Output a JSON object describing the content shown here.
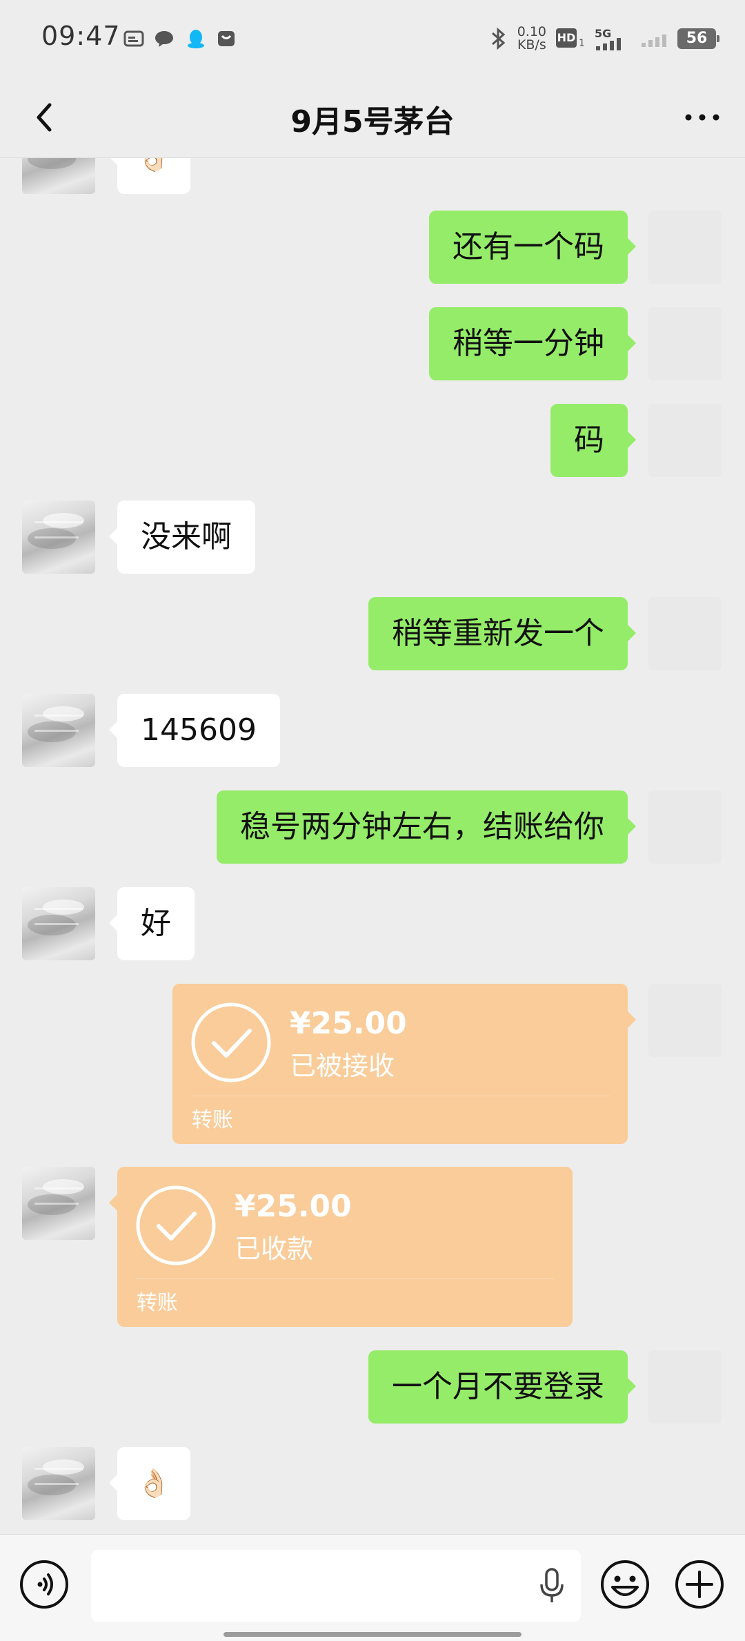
{
  "status_bar": {
    "time": "09:47",
    "net_speed_value": "0.10",
    "net_speed_unit": "KB/s",
    "hd_label": "HD",
    "network": "5G",
    "battery": "56"
  },
  "nav": {
    "title": "9月5号茅台"
  },
  "messages": [
    {
      "side": "in",
      "type": "emoji",
      "text": "👌🏻"
    },
    {
      "side": "out",
      "type": "text",
      "text": "还有一个码"
    },
    {
      "side": "out",
      "type": "text",
      "text": "稍等一分钟"
    },
    {
      "side": "out",
      "type": "text",
      "text": "码"
    },
    {
      "side": "in",
      "type": "text",
      "text": "没来啊"
    },
    {
      "side": "out",
      "type": "text",
      "text": "稍等重新发一个"
    },
    {
      "side": "in",
      "type": "text",
      "text": "145609"
    },
    {
      "side": "out",
      "type": "text",
      "text": "稳号两分钟左右，结账给你"
    },
    {
      "side": "in",
      "type": "text",
      "text": "好"
    },
    {
      "side": "out",
      "type": "transfer",
      "amount": "¥25.00",
      "status": "已被接收",
      "label": "转账"
    },
    {
      "side": "in",
      "type": "transfer",
      "amount": "¥25.00",
      "status": "已收款",
      "label": "转账"
    },
    {
      "side": "out",
      "type": "text",
      "text": "一个月不要登录"
    },
    {
      "side": "in",
      "type": "emoji",
      "text": "👌🏻"
    }
  ],
  "colors": {
    "background": "#ededed",
    "outgoing_bubble": "#95ec69",
    "incoming_bubble": "#ffffff",
    "transfer_card": "#f9cc9a"
  }
}
